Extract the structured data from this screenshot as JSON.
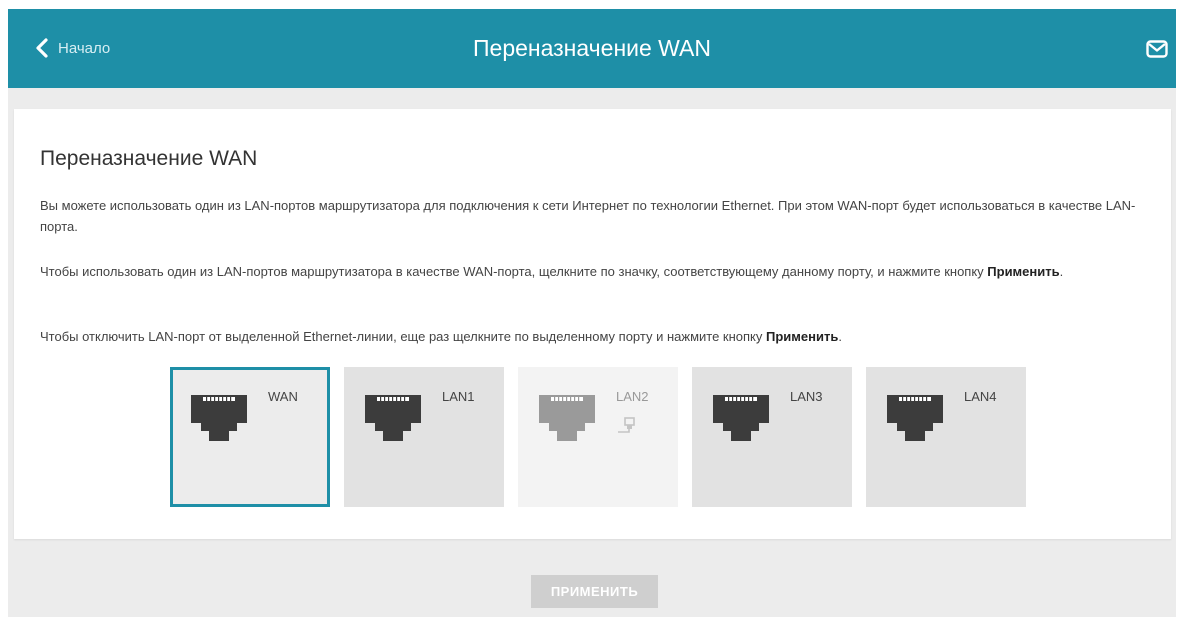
{
  "header": {
    "back_label": "Начало",
    "title": "Переназначение WAN"
  },
  "card": {
    "heading": "Переназначение WAN",
    "paragraph1": "Вы можете использовать один из LAN-портов маршрутизатора для подключения к сети Интернет по технологии Ethernet. При этом WAN-порт будет использоваться в качестве LAN-порта.",
    "paragraph2_text": "Чтобы использовать один из LAN-портов маршрутизатора в качестве WAN-порта, щелкните по значку, соответствующему данному порту, и нажмите кнопку ",
    "paragraph2_bold": "Применить",
    "paragraph2_end": ".",
    "paragraph3_text": "Чтобы отключить LAN-порт от выделенной Ethernet-линии, еще раз щелкните по выделенному порту и нажмите кнопку ",
    "paragraph3_bold": "Применить",
    "paragraph3_end": "."
  },
  "ports": [
    {
      "label": "WAN",
      "state": "selected",
      "icon": "ethernet-port-icon"
    },
    {
      "label": "LAN1",
      "state": "normal",
      "icon": "ethernet-port-icon"
    },
    {
      "label": "LAN2",
      "state": "disabled",
      "icon": "ethernet-port-icon",
      "extra_icon": "cable-connected-icon"
    },
    {
      "label": "LAN3",
      "state": "normal",
      "icon": "ethernet-port-icon"
    },
    {
      "label": "LAN4",
      "state": "normal",
      "icon": "ethernet-port-icon"
    }
  ],
  "apply_button": "ПРИМЕНИТЬ",
  "colors": {
    "accent": "#1e8fa7",
    "tile": "#e2e2e2",
    "jack": "#3c3c3c",
    "jack_disabled": "#9a9a9a",
    "button_disabled": "#cfcfcf"
  }
}
